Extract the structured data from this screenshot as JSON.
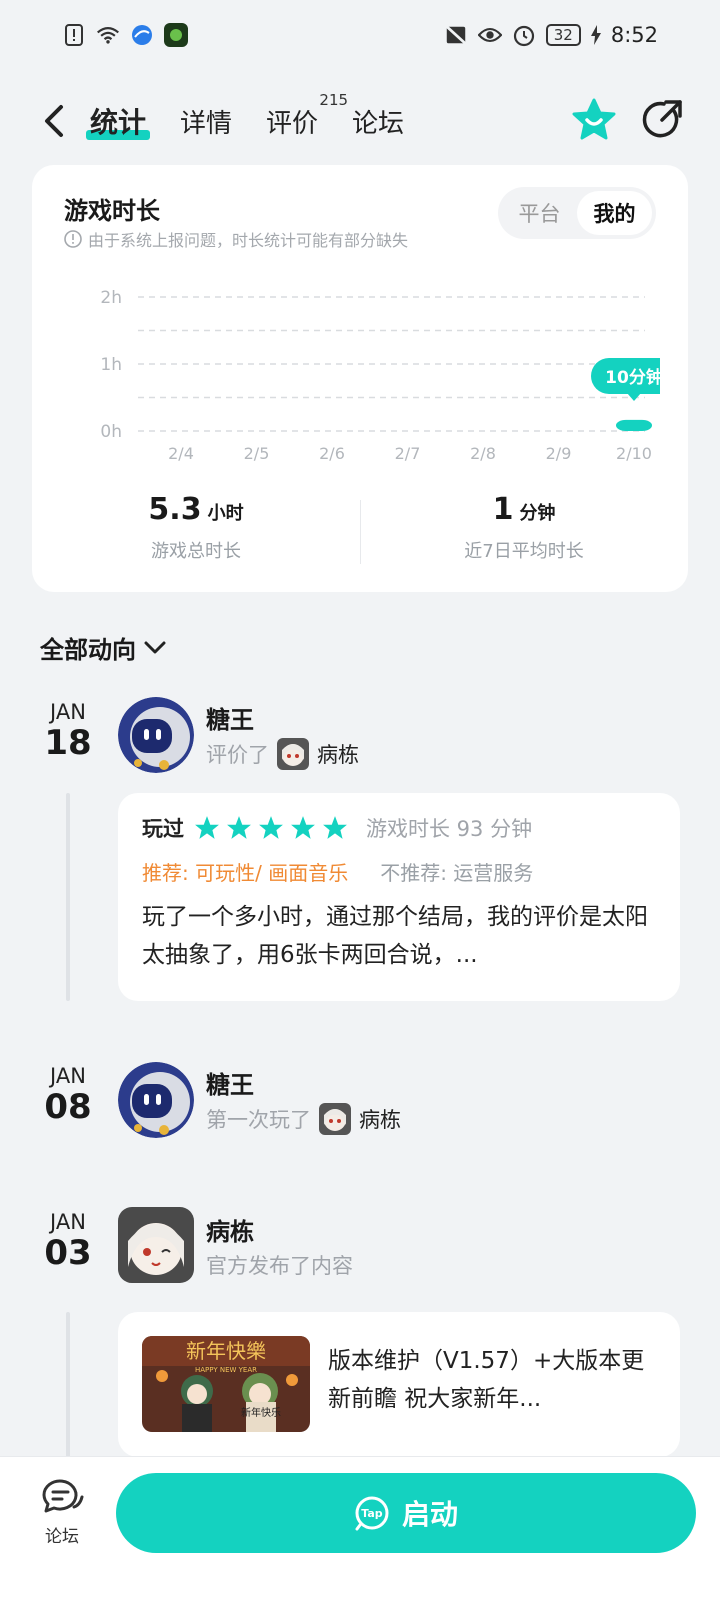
{
  "status_bar": {
    "time": "8:52",
    "battery": "32"
  },
  "nav": {
    "tabs": [
      {
        "label": "统计"
      },
      {
        "label": "详情"
      },
      {
        "label": "评价",
        "count": "215"
      },
      {
        "label": "论坛"
      }
    ]
  },
  "playtime_card": {
    "title": "游戏时长",
    "note": "由于系统上报问题，时长统计可能有部分缺失",
    "toggle": [
      "平台",
      "我的"
    ],
    "stats": [
      {
        "value": "5.3",
        "unit": "小时",
        "label": "游戏总时长"
      },
      {
        "value": "1",
        "unit": "分钟",
        "label": "近7日平均时长"
      }
    ]
  },
  "chart_data": {
    "type": "bar",
    "categories": [
      "2/4",
      "2/5",
      "2/6",
      "2/7",
      "2/8",
      "2/9",
      "2/10"
    ],
    "values": [
      0,
      0,
      0,
      0,
      0,
      0,
      10
    ],
    "value_unit": "minutes",
    "y_ticks": [
      "2h",
      "1h",
      "0h"
    ],
    "ylim": [
      0,
      120
    ],
    "tooltip": "10分钟",
    "grid": true,
    "color": "#14d2c0"
  },
  "activity": {
    "section_title": "全部动向",
    "items": [
      {
        "month": "JAN",
        "day": "18",
        "user": "糖王",
        "action": "评价了",
        "game": "病栋"
      },
      {
        "month": "JAN",
        "day": "08",
        "user": "糖王",
        "action": "第一次玩了",
        "game": "病栋"
      },
      {
        "month": "JAN",
        "day": "03",
        "user": "病栋",
        "action": "官方发布了内容"
      }
    ],
    "review": {
      "played": "玩过",
      "stars": 5,
      "playtime": "游戏时长 93 分钟",
      "recommend": "推荐: 可玩性/ 画面音乐",
      "not_recommend": "不推荐: 运营服务",
      "text": "玩了一个多小时，通过那个结局，我的评价是太阳太抽象了，用6张卡两回合说，..."
    },
    "news": {
      "thumb_text": "新年快樂",
      "thumb_sub": "HAPPY NEW YEAR",
      "thumb_sign": "新年快乐",
      "text": "版本维护（V1.57）+大版本更新前瞻 祝大家新年..."
    }
  },
  "bottom": {
    "forum_label": "论坛",
    "launch_label": "启动",
    "tap_logo": "Tap"
  },
  "colors": {
    "accent": "#14d2c0",
    "recommend": "#f08a34"
  }
}
